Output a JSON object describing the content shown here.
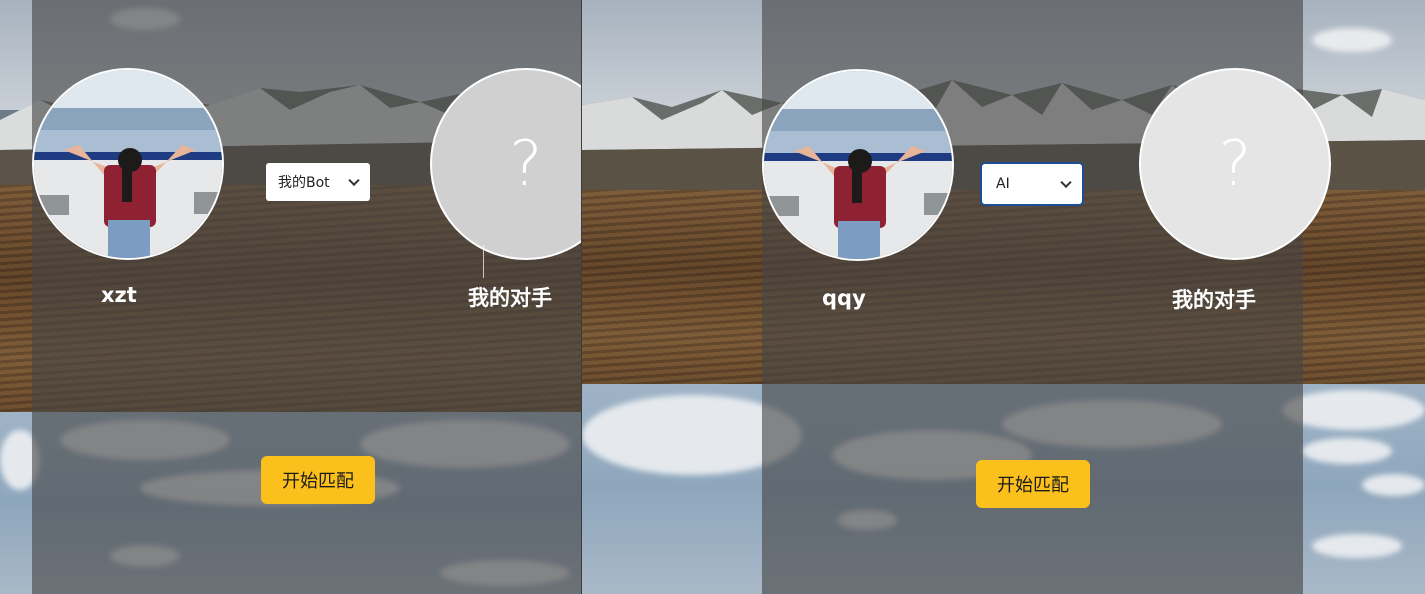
{
  "left_panel": {
    "player_name": "xzt",
    "opponent_name": "我的对手",
    "opponent_placeholder": "?",
    "mode_select": {
      "selected": "我的Bot"
    },
    "start_button": "开始匹配"
  },
  "right_panel": {
    "player_name": "qqy",
    "opponent_name": "我的对手",
    "opponent_placeholder": "?",
    "mode_select": {
      "selected": "AI"
    },
    "start_button": "开始匹配"
  },
  "colors": {
    "start_button": "#fbc01b",
    "select_focus": "#1c4e97",
    "overlay": "rgba(70,70,70,0.62)"
  },
  "icons": [
    "chevron-down-icon",
    "avatar-photo",
    "question-mark-icon"
  ]
}
